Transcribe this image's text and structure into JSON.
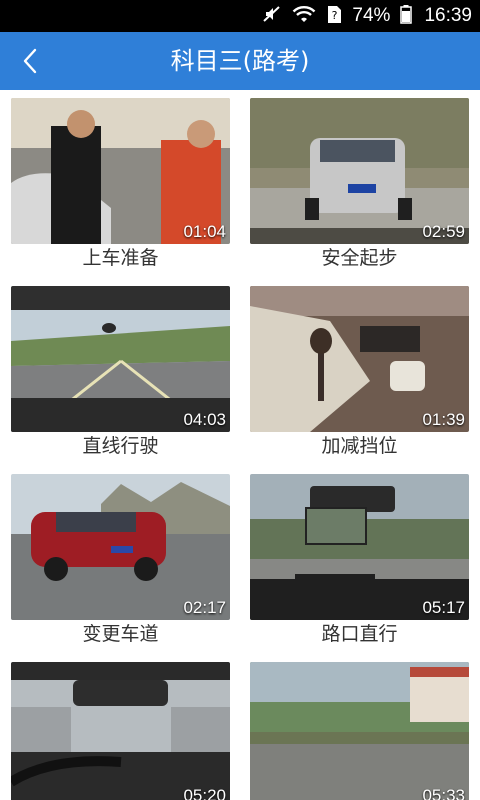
{
  "status": {
    "battery": "74%",
    "time": "16:39"
  },
  "header": {
    "title": "科目三(路考)"
  },
  "videos": [
    {
      "label": "上车准备",
      "duration": "01:04"
    },
    {
      "label": "安全起步",
      "duration": "02:59"
    },
    {
      "label": "直线行驶",
      "duration": "04:03"
    },
    {
      "label": "加减挡位",
      "duration": "01:39"
    },
    {
      "label": "变更车道",
      "duration": "02:17"
    },
    {
      "label": "路口直行",
      "duration": "05:17"
    },
    {
      "label": "",
      "duration": "05:20"
    },
    {
      "label": "",
      "duration": "05:33"
    }
  ]
}
